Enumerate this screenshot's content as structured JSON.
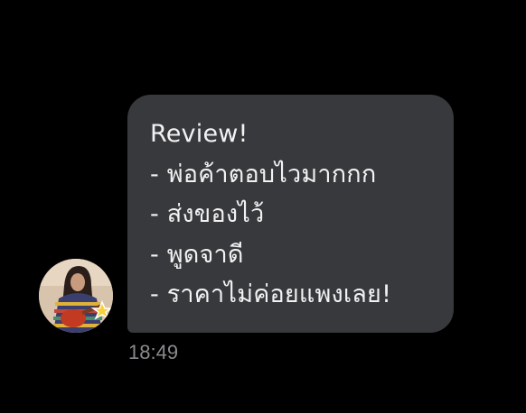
{
  "message": {
    "lines": [
      "Review!",
      "- พ่อค้าตอบไวมากกก",
      "- ส่งของไว้",
      "- พูดจาดี",
      "- ราคาไม่ค่อยแพงเลย!"
    ],
    "time": "18:49"
  },
  "colors": {
    "background": "#000000",
    "bubble": "#37393c",
    "text": "#f2f2f2",
    "timestamp": "#8a8a8e"
  }
}
